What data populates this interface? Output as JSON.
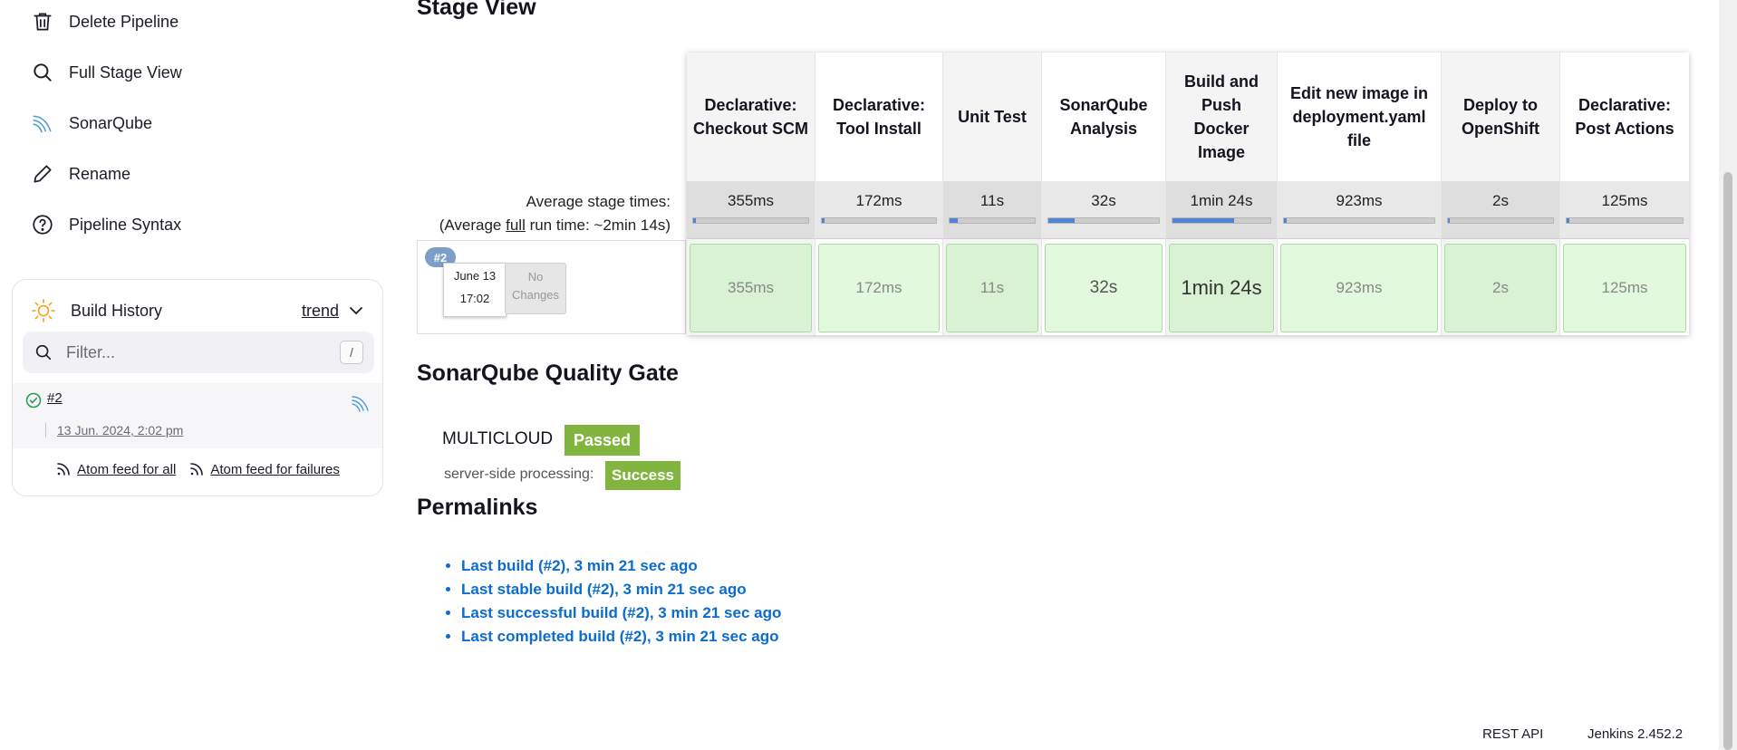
{
  "sidebar": {
    "tasks": [
      {
        "label": "Delete Pipeline",
        "icon": "trash-icon"
      },
      {
        "label": "Full Stage View",
        "icon": "search-icon"
      },
      {
        "label": "SonarQube",
        "icon": "sonarqube-icon"
      },
      {
        "label": "Rename",
        "icon": "pencil-icon"
      },
      {
        "label": "Pipeline Syntax",
        "icon": "help-circle-icon"
      }
    ]
  },
  "build_history": {
    "title": "Build History",
    "trend_label": "trend",
    "filter_placeholder": "Filter...",
    "filter_shortcut": "/",
    "builds": [
      {
        "number": "#2",
        "date": "13 Jun. 2024, 2:02 pm",
        "status": "success"
      }
    ],
    "feeds": {
      "all": "Atom feed for all",
      "failures": "Atom feed for failures"
    }
  },
  "stage_view": {
    "title": "Stage View",
    "avg_label": "Average stage times:",
    "avg_run_prefix": "(Average ",
    "avg_run_link": "full",
    "avg_run_suffix": " run time: ~2min 14s)",
    "stages": [
      {
        "name": "Declarative: Checkout SCM",
        "avg": "355ms",
        "run": "355ms",
        "avg_fraction": 0.01
      },
      {
        "name": "Declarative: Tool Install",
        "avg": "172ms",
        "run": "172ms",
        "avg_fraction": 0.01
      },
      {
        "name": "Unit Test",
        "avg": "11s",
        "run": "11s",
        "avg_fraction": 0.1
      },
      {
        "name": "SonarQube Analysis",
        "avg": "32s",
        "run": "32s",
        "avg_fraction": 0.24
      },
      {
        "name": "Build and Push Docker Image",
        "avg": "1min 24s",
        "run": "1min 24s",
        "avg_fraction": 0.63
      },
      {
        "name": "Edit new image in deployment.yaml file",
        "avg": "923ms",
        "run": "923ms",
        "avg_fraction": 0.01
      },
      {
        "name": "Deploy to OpenShift",
        "avg": "2s",
        "run": "2s",
        "avg_fraction": 0.02
      },
      {
        "name": "Declarative: Post Actions",
        "avg": "125ms",
        "run": "125ms",
        "avg_fraction": 0.01
      }
    ],
    "run": {
      "badge": "#2",
      "date_line1": "June 13",
      "date_line2": "17:02",
      "changes": "No Changes"
    },
    "colors": {
      "success_cell": "#e2f9dd",
      "success_cell_alt": "#d9f2d3",
      "avg_bar": "#4f84d6"
    }
  },
  "quality_gate": {
    "title": "SonarQube Quality Gate",
    "project": "MULTICLOUD",
    "status": "Passed",
    "ssp_label": "server-side processing:",
    "ssp_status": "Success",
    "color": "#82b440"
  },
  "permalinks": {
    "title": "Permalinks",
    "items": [
      "Last build (#2), 3 min 21 sec ago",
      "Last stable build (#2), 3 min 21 sec ago",
      "Last successful build (#2), 3 min 21 sec ago",
      "Last completed build (#2), 3 min 21 sec ago"
    ]
  },
  "footer": {
    "rest_api": "REST API",
    "version": "Jenkins 2.452.2"
  }
}
